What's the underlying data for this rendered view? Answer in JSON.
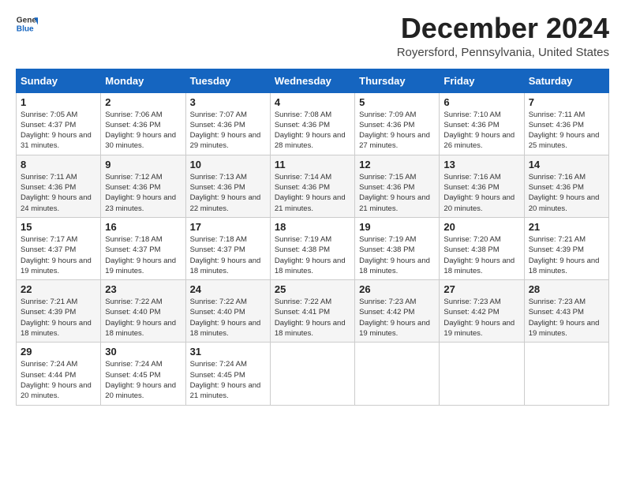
{
  "header": {
    "logo_general": "General",
    "logo_blue": "Blue",
    "title": "December 2024",
    "subtitle": "Royersford, Pennsylvania, United States"
  },
  "weekdays": [
    "Sunday",
    "Monday",
    "Tuesday",
    "Wednesday",
    "Thursday",
    "Friday",
    "Saturday"
  ],
  "weeks": [
    [
      {
        "day": "1",
        "sunrise": "7:05 AM",
        "sunset": "4:37 PM",
        "daylight": "9 hours and 31 minutes."
      },
      {
        "day": "2",
        "sunrise": "7:06 AM",
        "sunset": "4:36 PM",
        "daylight": "9 hours and 30 minutes."
      },
      {
        "day": "3",
        "sunrise": "7:07 AM",
        "sunset": "4:36 PM",
        "daylight": "9 hours and 29 minutes."
      },
      {
        "day": "4",
        "sunrise": "7:08 AM",
        "sunset": "4:36 PM",
        "daylight": "9 hours and 28 minutes."
      },
      {
        "day": "5",
        "sunrise": "7:09 AM",
        "sunset": "4:36 PM",
        "daylight": "9 hours and 27 minutes."
      },
      {
        "day": "6",
        "sunrise": "7:10 AM",
        "sunset": "4:36 PM",
        "daylight": "9 hours and 26 minutes."
      },
      {
        "day": "7",
        "sunrise": "7:11 AM",
        "sunset": "4:36 PM",
        "daylight": "9 hours and 25 minutes."
      }
    ],
    [
      {
        "day": "8",
        "sunrise": "7:11 AM",
        "sunset": "4:36 PM",
        "daylight": "9 hours and 24 minutes."
      },
      {
        "day": "9",
        "sunrise": "7:12 AM",
        "sunset": "4:36 PM",
        "daylight": "9 hours and 23 minutes."
      },
      {
        "day": "10",
        "sunrise": "7:13 AM",
        "sunset": "4:36 PM",
        "daylight": "9 hours and 22 minutes."
      },
      {
        "day": "11",
        "sunrise": "7:14 AM",
        "sunset": "4:36 PM",
        "daylight": "9 hours and 21 minutes."
      },
      {
        "day": "12",
        "sunrise": "7:15 AM",
        "sunset": "4:36 PM",
        "daylight": "9 hours and 21 minutes."
      },
      {
        "day": "13",
        "sunrise": "7:16 AM",
        "sunset": "4:36 PM",
        "daylight": "9 hours and 20 minutes."
      },
      {
        "day": "14",
        "sunrise": "7:16 AM",
        "sunset": "4:36 PM",
        "daylight": "9 hours and 20 minutes."
      }
    ],
    [
      {
        "day": "15",
        "sunrise": "7:17 AM",
        "sunset": "4:37 PM",
        "daylight": "9 hours and 19 minutes."
      },
      {
        "day": "16",
        "sunrise": "7:18 AM",
        "sunset": "4:37 PM",
        "daylight": "9 hours and 19 minutes."
      },
      {
        "day": "17",
        "sunrise": "7:18 AM",
        "sunset": "4:37 PM",
        "daylight": "9 hours and 18 minutes."
      },
      {
        "day": "18",
        "sunrise": "7:19 AM",
        "sunset": "4:38 PM",
        "daylight": "9 hours and 18 minutes."
      },
      {
        "day": "19",
        "sunrise": "7:19 AM",
        "sunset": "4:38 PM",
        "daylight": "9 hours and 18 minutes."
      },
      {
        "day": "20",
        "sunrise": "7:20 AM",
        "sunset": "4:38 PM",
        "daylight": "9 hours and 18 minutes."
      },
      {
        "day": "21",
        "sunrise": "7:21 AM",
        "sunset": "4:39 PM",
        "daylight": "9 hours and 18 minutes."
      }
    ],
    [
      {
        "day": "22",
        "sunrise": "7:21 AM",
        "sunset": "4:39 PM",
        "daylight": "9 hours and 18 minutes."
      },
      {
        "day": "23",
        "sunrise": "7:22 AM",
        "sunset": "4:40 PM",
        "daylight": "9 hours and 18 minutes."
      },
      {
        "day": "24",
        "sunrise": "7:22 AM",
        "sunset": "4:40 PM",
        "daylight": "9 hours and 18 minutes."
      },
      {
        "day": "25",
        "sunrise": "7:22 AM",
        "sunset": "4:41 PM",
        "daylight": "9 hours and 18 minutes."
      },
      {
        "day": "26",
        "sunrise": "7:23 AM",
        "sunset": "4:42 PM",
        "daylight": "9 hours and 19 minutes."
      },
      {
        "day": "27",
        "sunrise": "7:23 AM",
        "sunset": "4:42 PM",
        "daylight": "9 hours and 19 minutes."
      },
      {
        "day": "28",
        "sunrise": "7:23 AM",
        "sunset": "4:43 PM",
        "daylight": "9 hours and 19 minutes."
      }
    ],
    [
      {
        "day": "29",
        "sunrise": "7:24 AM",
        "sunset": "4:44 PM",
        "daylight": "9 hours and 20 minutes."
      },
      {
        "day": "30",
        "sunrise": "7:24 AM",
        "sunset": "4:45 PM",
        "daylight": "9 hours and 20 minutes."
      },
      {
        "day": "31",
        "sunrise": "7:24 AM",
        "sunset": "4:45 PM",
        "daylight": "9 hours and 21 minutes."
      },
      null,
      null,
      null,
      null
    ]
  ]
}
